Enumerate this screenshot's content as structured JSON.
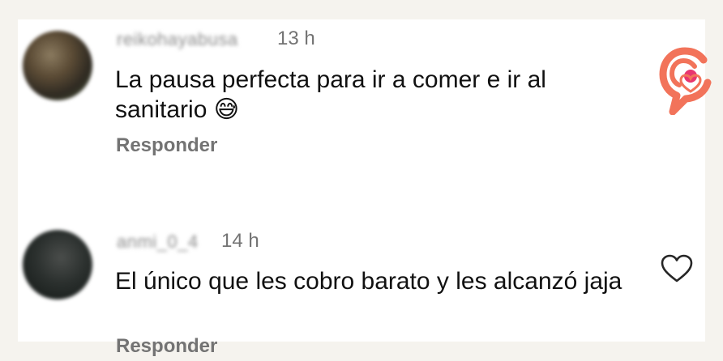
{
  "comments": [
    {
      "username": "reikohayabusa",
      "time": "13 h",
      "text": "La pausa perfecta para ir a comer e ir al sanitario 😅",
      "reply_label": "Responder",
      "avatar_icon": "user-avatar",
      "like_icon": "heart-icon"
    },
    {
      "username": "anmi_0_4",
      "time": "14 h",
      "text": "El único que les cobro barato y les alcanzó jaja",
      "reply_label": "Responder",
      "avatar_icon": "user-avatar",
      "like_icon": "heart-icon"
    }
  ],
  "brand": {
    "logo_icon": "brand-logo-icon",
    "accent_color": "#f2735a",
    "dot_color": "#e8356f"
  }
}
